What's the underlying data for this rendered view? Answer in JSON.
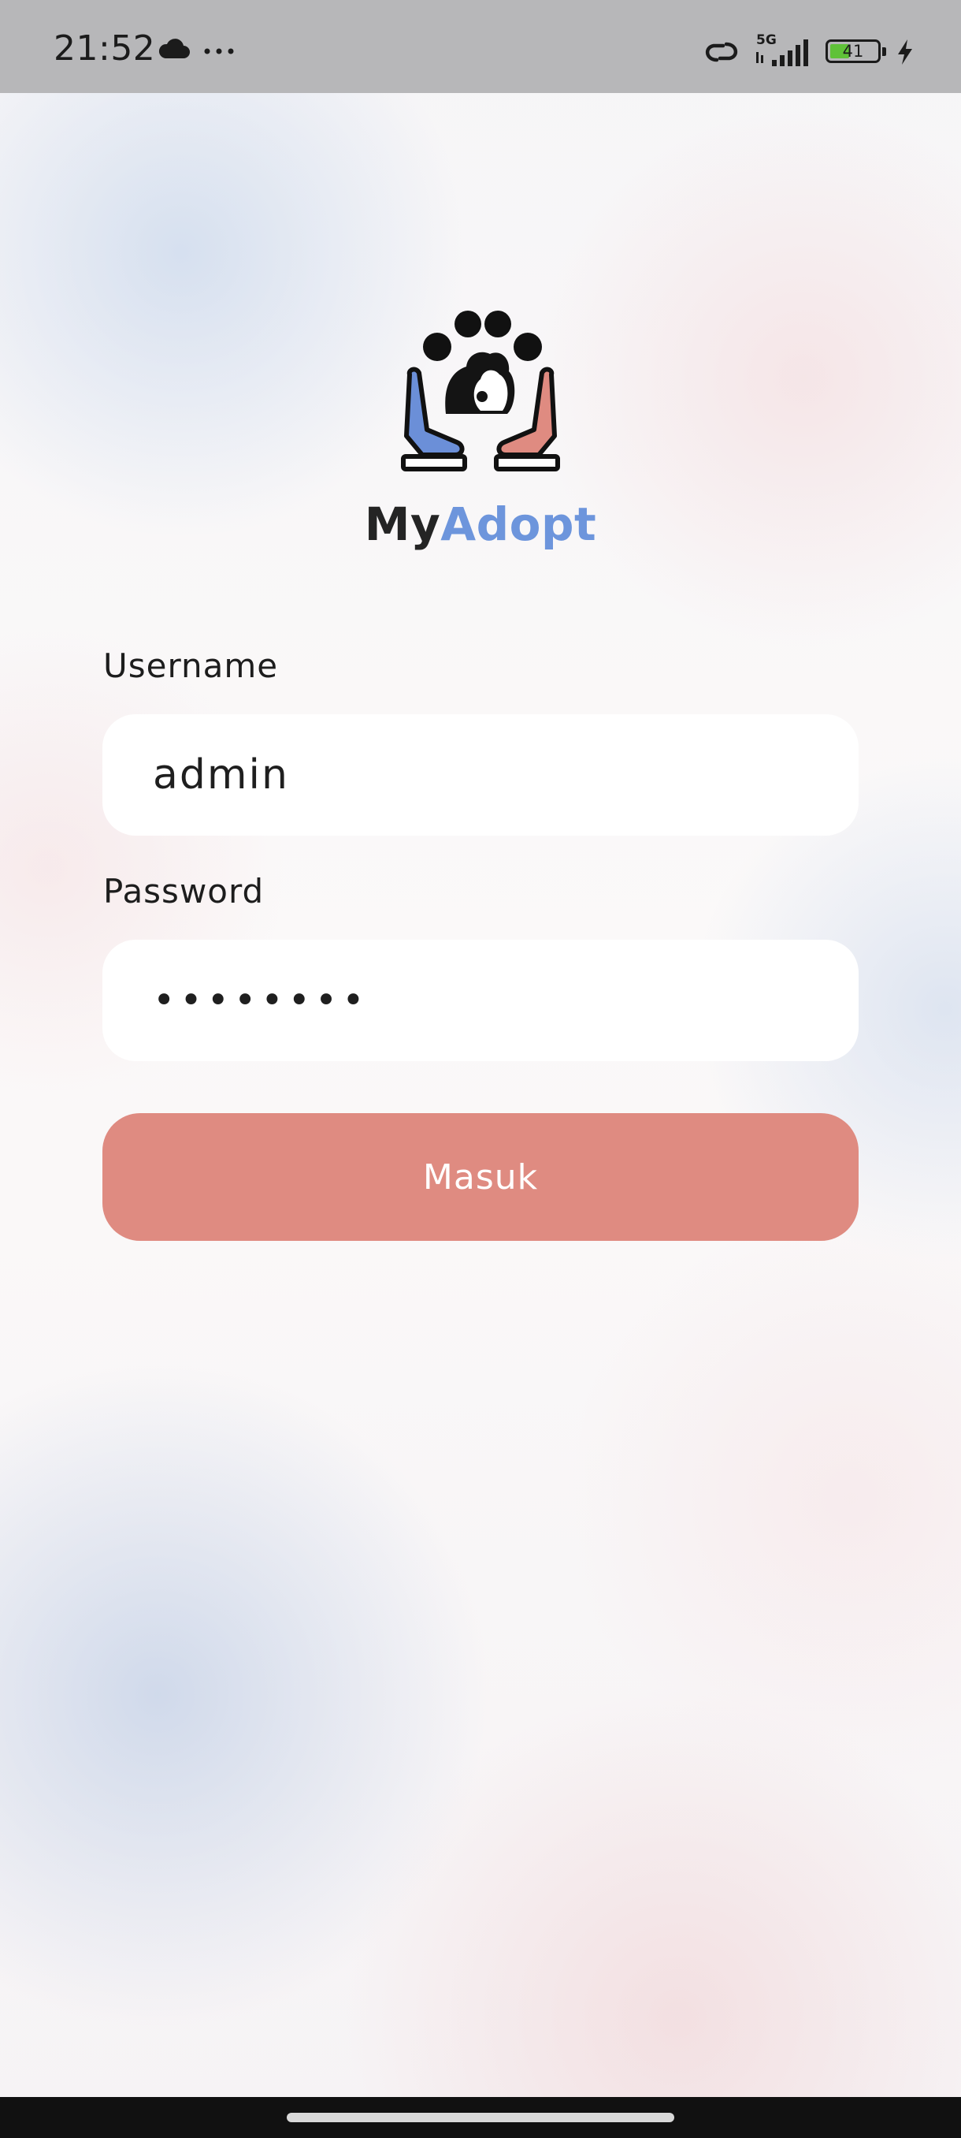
{
  "status_bar": {
    "time": "21:52",
    "network": "5G",
    "battery_level": "41",
    "battery_percent": 41,
    "icons": [
      "cloud-icon",
      "more-icon",
      "link-icon",
      "signal-icon",
      "battery-icon",
      "charging-bolt-icon"
    ]
  },
  "app": {
    "brand_first": "My",
    "brand_second": "Adopt",
    "logo_icon": "hands-paw-pet-logo",
    "colors": {
      "brand_blue": "#6d95dc",
      "brand_salmon": "#df8b81",
      "text_dark": "#1d1d1d"
    }
  },
  "form": {
    "username_label": "Username",
    "username_value": "admin",
    "password_label": "Password",
    "password_value": "••••••••",
    "submit_label": "Masuk"
  }
}
